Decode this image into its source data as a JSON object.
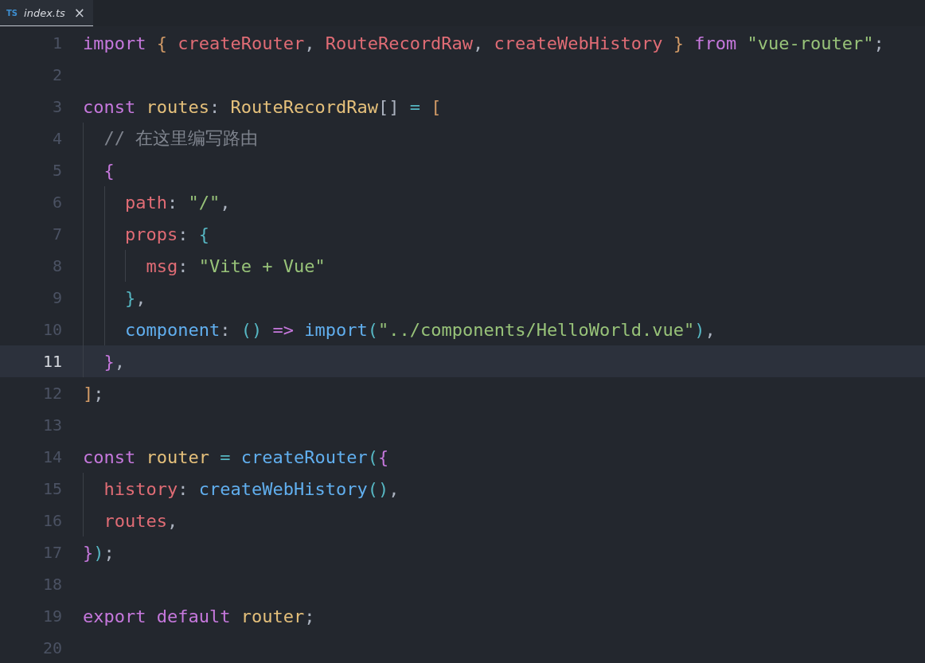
{
  "tab": {
    "icon_text": "TS",
    "title": "index.ts",
    "close": "×",
    "selected": true
  },
  "lines": [
    {
      "number": "1",
      "selected": false,
      "tokens": [
        {
          "text": "import ",
          "color": "#c678dd"
        },
        {
          "text": "{ ",
          "color": "#d19a66"
        },
        {
          "text": "createRouter",
          "color": "#e06c75"
        },
        {
          "text": ", ",
          "color": "#abb2bf"
        },
        {
          "text": "RouteRecordRaw",
          "color": "#e06c75"
        },
        {
          "text": ", ",
          "color": "#abb2bf"
        },
        {
          "text": "createWebHistory ",
          "color": "#e06c75"
        },
        {
          "text": "} ",
          "color": "#d19a66"
        },
        {
          "text": "from ",
          "color": "#c678dd"
        },
        {
          "text": "\"vue-router\"",
          "color": "#98c379"
        },
        {
          "text": ";",
          "color": "#abb2bf"
        }
      ]
    },
    {
      "number": "2",
      "selected": false
    },
    {
      "number": "3",
      "selected": false,
      "tokens": [
        {
          "text": "const ",
          "color": "#c678dd"
        },
        {
          "text": "routes",
          "color": "#e5c07b"
        },
        {
          "text": ": ",
          "color": "#abb2bf"
        },
        {
          "text": "RouteRecordRaw",
          "color": "#e5c07b"
        },
        {
          "text": "[] ",
          "color": "#abb2bf"
        },
        {
          "text": "= ",
          "color": "#56b6c2"
        },
        {
          "text": "[",
          "color": "#d19a66"
        }
      ],
      "children": [
        {
          "number": "4",
          "selected": false,
          "tokens": [
            {
              "text": "// 在这里编写路由",
              "color": "#7f848e"
            }
          ]
        },
        {
          "number": "5",
          "selected": false,
          "tokens": [
            {
              "text": "{",
              "color": "#c678dd"
            }
          ],
          "children": [
            {
              "number": "6",
              "selected": false,
              "tokens": [
                {
                  "text": "path",
                  "color": "#e06c75"
                },
                {
                  "text": ": ",
                  "color": "#abb2bf"
                },
                {
                  "text": "\"/\"",
                  "color": "#98c379"
                },
                {
                  "text": ",",
                  "color": "#abb2bf"
                }
              ]
            },
            {
              "number": "7",
              "selected": false,
              "tokens": [
                {
                  "text": "props",
                  "color": "#e06c75"
                },
                {
                  "text": ": ",
                  "color": "#abb2bf"
                },
                {
                  "text": "{",
                  "color": "#56b6c2"
                }
              ],
              "children": [
                {
                  "number": "8",
                  "selected": false,
                  "tokens": [
                    {
                      "text": "msg",
                      "color": "#e06c75"
                    },
                    {
                      "text": ": ",
                      "color": "#abb2bf"
                    },
                    {
                      "text": "\"Vite + Vue\"",
                      "color": "#98c379"
                    }
                  ]
                }
              ]
            },
            {
              "number": "9",
              "selected": false,
              "tokens": [
                {
                  "text": "}",
                  "color": "#56b6c2"
                },
                {
                  "text": ",",
                  "color": "#abb2bf"
                }
              ]
            },
            {
              "number": "10",
              "selected": false,
              "tokens": [
                {
                  "text": "component",
                  "color": "#61afef"
                },
                {
                  "text": ": ",
                  "color": "#abb2bf"
                },
                {
                  "text": "() ",
                  "color": "#56b6c2"
                },
                {
                  "text": "=> ",
                  "color": "#c678dd"
                },
                {
                  "text": "import",
                  "color": "#61afef"
                },
                {
                  "text": "(",
                  "color": "#56b6c2"
                },
                {
                  "text": "\"../components/HelloWorld.vue\"",
                  "color": "#98c379"
                },
                {
                  "text": ")",
                  "color": "#56b6c2"
                },
                {
                  "text": ",",
                  "color": "#abb2bf"
                }
              ]
            }
          ]
        },
        {
          "number": "11",
          "selected": true,
          "tokens": [
            {
              "text": "}",
              "color": "#c678dd"
            },
            {
              "text": ",",
              "color": "#abb2bf"
            }
          ]
        }
      ]
    },
    {
      "number": "12",
      "selected": false,
      "tokens": [
        {
          "text": "]",
          "color": "#d19a66"
        },
        {
          "text": ";",
          "color": "#abb2bf"
        }
      ]
    },
    {
      "number": "13",
      "selected": false
    },
    {
      "number": "14",
      "selected": false,
      "tokens": [
        {
          "text": "const ",
          "color": "#c678dd"
        },
        {
          "text": "router ",
          "color": "#e5c07b"
        },
        {
          "text": "= ",
          "color": "#56b6c2"
        },
        {
          "text": "createRouter",
          "color": "#61afef"
        },
        {
          "text": "(",
          "color": "#56b6c2"
        },
        {
          "text": "{",
          "color": "#c678dd"
        }
      ],
      "children": [
        {
          "number": "15",
          "selected": false,
          "tokens": [
            {
              "text": "history",
              "color": "#e06c75"
            },
            {
              "text": ": ",
              "color": "#abb2bf"
            },
            {
              "text": "createWebHistory",
              "color": "#61afef"
            },
            {
              "text": "()",
              "color": "#56b6c2"
            },
            {
              "text": ",",
              "color": "#abb2bf"
            }
          ]
        },
        {
          "number": "16",
          "selected": false,
          "tokens": [
            {
              "text": "routes",
              "color": "#e06c75"
            },
            {
              "text": ",",
              "color": "#abb2bf"
            }
          ]
        }
      ]
    },
    {
      "number": "17",
      "selected": false,
      "tokens": [
        {
          "text": "}",
          "color": "#c678dd"
        },
        {
          "text": ")",
          "color": "#56b6c2"
        },
        {
          "text": ";",
          "color": "#abb2bf"
        }
      ]
    },
    {
      "number": "18",
      "selected": false
    },
    {
      "number": "19",
      "selected": false,
      "tokens": [
        {
          "text": "export ",
          "color": "#c678dd"
        },
        {
          "text": "default ",
          "color": "#c678dd"
        },
        {
          "text": "router",
          "color": "#e5c07b"
        },
        {
          "text": ";",
          "color": "#abb2bf"
        }
      ]
    },
    {
      "number": "20",
      "selected": false
    }
  ]
}
